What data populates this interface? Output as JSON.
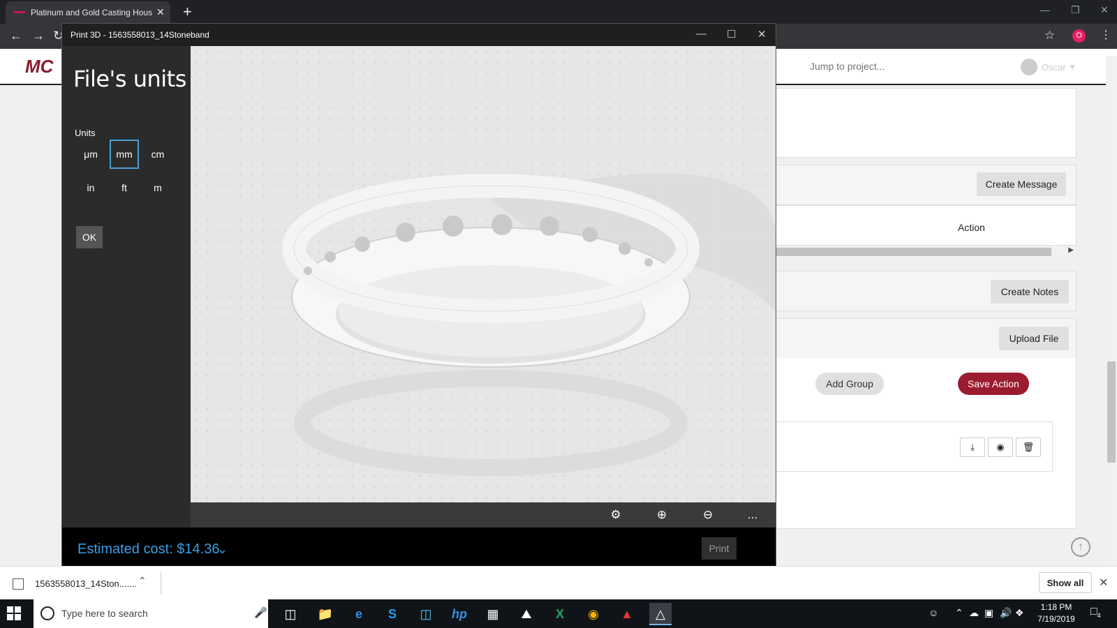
{
  "browser": {
    "tab_title": "Platinum and Gold Casting House",
    "tab_close": "✕",
    "new_tab": "+",
    "profile_initial": "O"
  },
  "site": {
    "logo": "MC",
    "jump_placeholder": "Jump to project...",
    "user_name": "Oscar",
    "create_message": "Create Message",
    "action_header": "Action",
    "create_notes": "Create Notes",
    "upload_file": "Upload File",
    "add_group": "Add Group",
    "save_action": "Save Action",
    "file_row_icons": [
      "download-icon",
      "eye-icon",
      "trash-icon"
    ]
  },
  "print3d": {
    "window_title": "Print 3D - 1563558013_14Stoneband",
    "heading": "File's units",
    "units_label": "Units",
    "units": [
      "μm",
      "mm",
      "cm",
      "in",
      "ft",
      "m"
    ],
    "selected_unit": "mm",
    "ok_label": "OK",
    "toolbar_icons": [
      "reset-view-icon",
      "zoom-in-icon",
      "zoom-out-icon",
      "more-icon"
    ],
    "more_label": "...",
    "estimated_cost": "Estimated cost: $14.36",
    "print_label": "Print"
  },
  "downloads": {
    "file_name": "1563558013_14Ston.......",
    "show_all": "Show all"
  },
  "taskbar": {
    "search_placeholder": "Type here to search",
    "time": "1:18 PM",
    "date": "7/19/2019",
    "notification_count": "4"
  },
  "colors": {
    "accent_red": "#9b1b30",
    "print3d_blue": "#3a9ee4",
    "selected_border": "#4a9fd8"
  }
}
